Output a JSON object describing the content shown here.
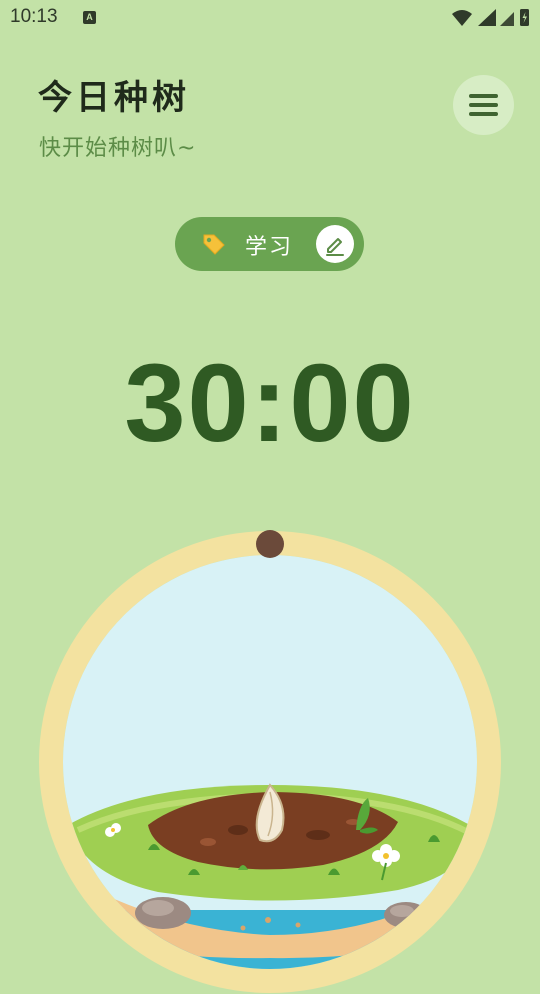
{
  "status_bar": {
    "time": "10:13",
    "notification_icon": "A",
    "icons": [
      "wifi-icon",
      "signal-icon",
      "signal-icon",
      "battery-charging-icon"
    ]
  },
  "header": {
    "title": "今日种树",
    "subtitle": "快开始种树叭~"
  },
  "menu_button": {
    "icon": "hamburger-menu-icon"
  },
  "tag": {
    "label": "学习",
    "icon": "tag-icon",
    "edit_icon": "pencil-edit-icon"
  },
  "timer": {
    "display": "30:00",
    "progress": 0
  },
  "colors": {
    "background": "#c3e2a7",
    "accent": "#6aa451",
    "timer_text": "#2f5a23",
    "ring": "#f3e2a0",
    "knob": "#6b4a3a"
  }
}
